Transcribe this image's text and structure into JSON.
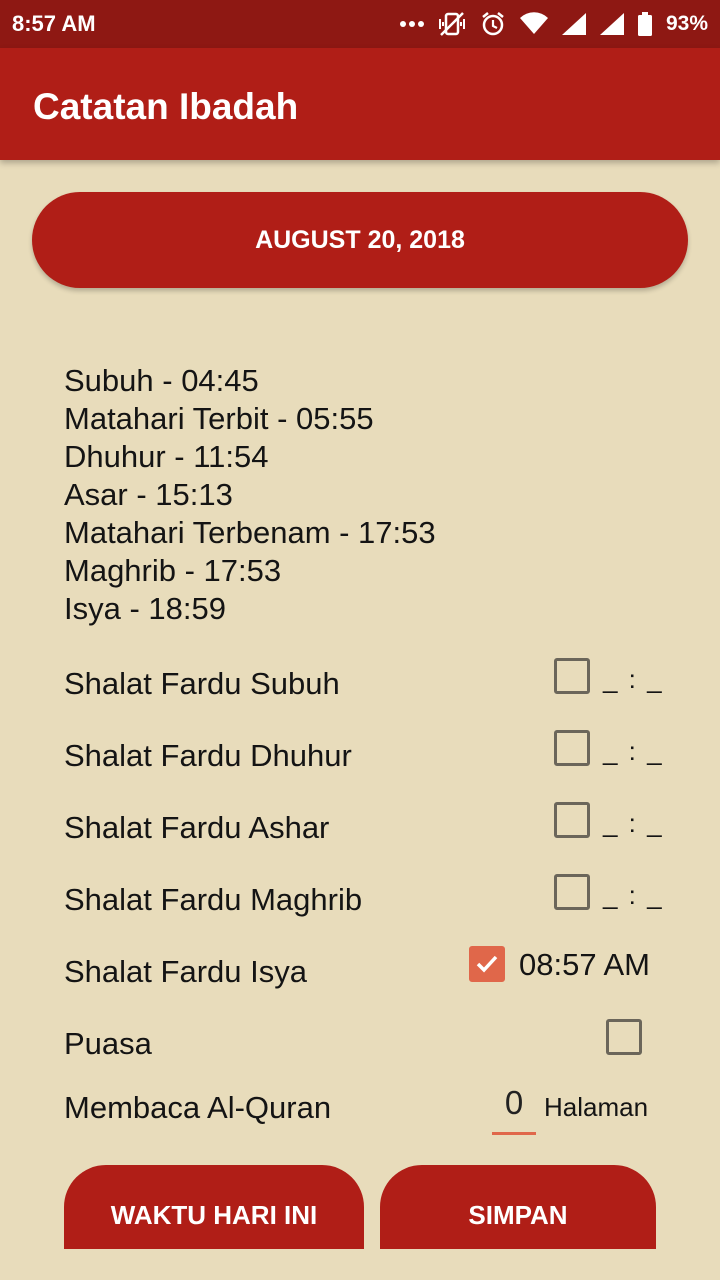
{
  "status_bar": {
    "time": "8:57 AM",
    "battery": "93%",
    "icons": [
      "more-dots-icon",
      "vibrate-off-icon",
      "alarm-icon",
      "wifi-icon",
      "signal-icon",
      "signal-icon",
      "battery-icon"
    ]
  },
  "app_bar": {
    "title": "Catatan Ibadah"
  },
  "date_button": {
    "label": "AUGUST 20, 2018"
  },
  "prayer_times": [
    "Subuh - 04:45",
    "Matahari Terbit - 05:55",
    "Dhuhur - 11:54",
    "Asar - 15:13",
    "Matahari Terbenam - 17:53",
    "Maghrib - 17:53",
    "Isya - 18:59"
  ],
  "checklist": [
    {
      "label": "Shalat Fardu Subuh",
      "checked": false,
      "time": "_ : _"
    },
    {
      "label": "Shalat Fardu Dhuhur",
      "checked": false,
      "time": "_ : _"
    },
    {
      "label": "Shalat Fardu Ashar",
      "checked": false,
      "time": "_ : _"
    },
    {
      "label": "Shalat Fardu Maghrib",
      "checked": false,
      "time": "_ : _"
    },
    {
      "label": "Shalat Fardu Isya",
      "checked": true,
      "time": "08:57 AM"
    },
    {
      "label": "Puasa",
      "checked": false
    }
  ],
  "quran": {
    "label": "Membaca Al-Quran",
    "value": "0",
    "unit": "Halaman"
  },
  "buttons": {
    "today": "WAKTU HARI INI",
    "save": "SIMPAN"
  },
  "colors": {
    "primary": "#b01e17",
    "status_bar": "#8e1813",
    "background": "#e8dcbb",
    "accent": "#e0674a"
  }
}
